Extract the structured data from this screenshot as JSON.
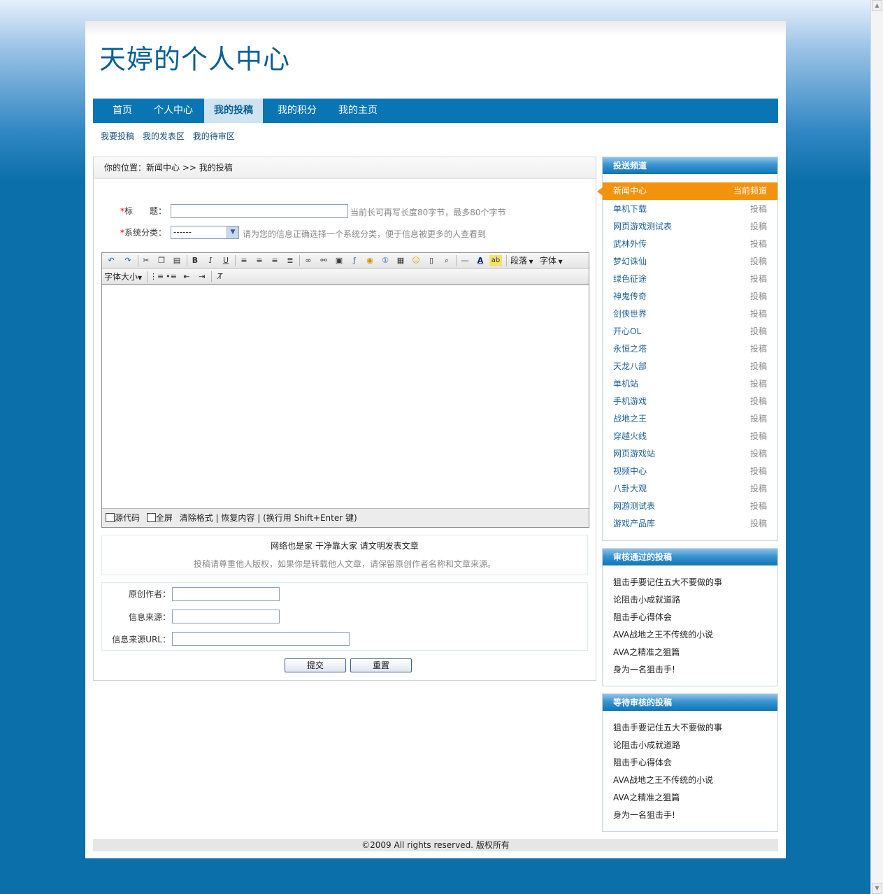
{
  "site": {
    "title": "天婷的个人中心"
  },
  "nav": [
    "首页",
    "个人中心",
    "我的投稿",
    "我的积分",
    "我的主页"
  ],
  "subnav": [
    "我要投稿",
    "我的发表区",
    "我的待审区"
  ],
  "breadcrumb": "你的位置：新闻中心  >> 我的投稿",
  "form": {
    "title_label": "标　　题：",
    "title_hint": "当前长可再写长度80字节，最多80个字节",
    "category_label": "系统分类：",
    "category_value": "------",
    "category_hint": "请为您的信息正确选择一个系统分类，便于信息被更多的人查看到",
    "author_label": "原创作者：",
    "source_label": "信息来源：",
    "source_url_label": "信息来源URL："
  },
  "editor": {
    "toolbar_row1_dropdowns": [
      "段落",
      "字体"
    ],
    "toolbar_row2_dropdown": "字体大小",
    "footer": {
      "source_code": "源代码",
      "fullscreen": "全屏",
      "clear_format": "清除格式",
      "restore": "恢复内容",
      "newline_hint": "(换行用 Shift+Enter 键)"
    }
  },
  "notice": {
    "line1": "网络也是家 干净靠大家 请文明发表文章",
    "line2": "投稿请尊重他人版权，如果你是转载他人文章，请保留原创作者名称和文章来源。"
  },
  "buttons": {
    "submit": "提交",
    "reset": "重置"
  },
  "channels": {
    "title": "投送频道",
    "current": {
      "name": "新闻中心",
      "tag": "当前频道"
    },
    "tag": "投稿",
    "items": [
      "单机下载",
      "网页游戏测试表",
      "武林外传",
      "梦幻诛仙",
      "绿色征途",
      "神鬼传奇",
      "剑侠世界",
      "开心OL",
      "永恒之塔",
      "天龙八部",
      "单机站",
      "手机游戏",
      "战地之王",
      "穿越火线",
      "网页游戏站",
      "视频中心",
      "八卦大观",
      "网游测试表",
      "游戏产品库"
    ]
  },
  "approved": {
    "title": "审核通过的投稿",
    "items": [
      "狙击手要记住五大不要做的事",
      "论阻击小成就道路",
      "阻击手心得体会",
      "AVA战地之王不传统的小说",
      "AVA之精准之狙篇",
      "身为一名狙击手!"
    ]
  },
  "pending": {
    "title": "等待审核的投稿",
    "items": [
      "狙击手要记住五大不要做的事",
      "论阻击小成就道路",
      "阻击手心得体会",
      "AVA战地之王不传统的小说",
      "AVA之精准之狙篇",
      "身为一名狙击手!"
    ]
  },
  "footer": "©2009 All rights reserved. 版权所有",
  "colors": {
    "nav": "#0a75b3",
    "accent": "#f3920c",
    "background": "#0b6fa9"
  }
}
